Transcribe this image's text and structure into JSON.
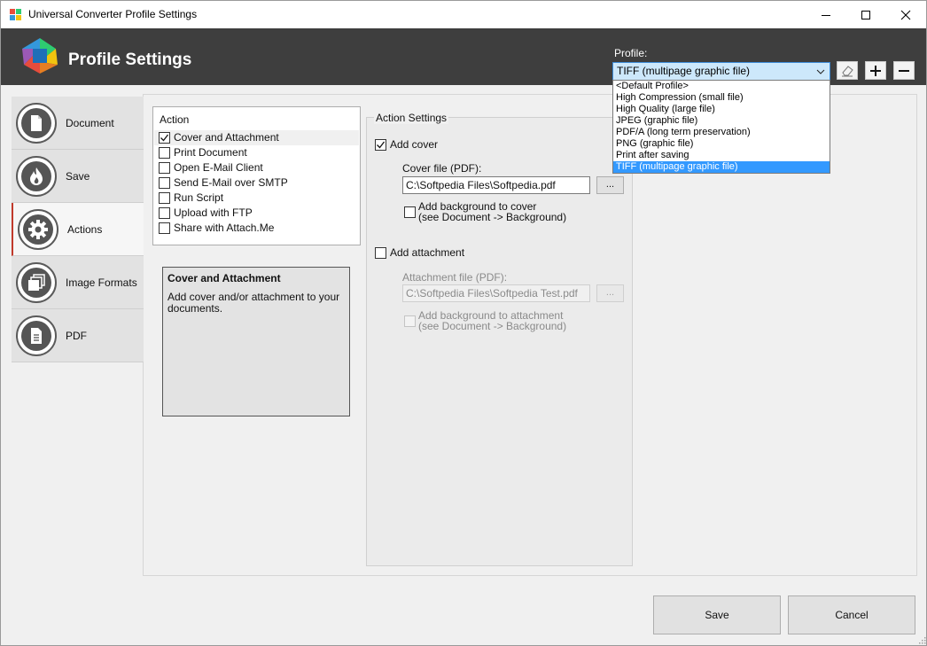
{
  "window": {
    "title": "Universal Converter Profile Settings",
    "controls": {
      "minimize": "minimize",
      "maximize": "maximize",
      "close": "close"
    }
  },
  "header": {
    "title": "Profile Settings",
    "profile_label": "Profile:",
    "profile_selected": "TIFF (multipage graphic file)",
    "profile_options": [
      "<Default Profile>",
      "High Compression (small file)",
      "High Quality (large file)",
      "JPEG (graphic file)",
      "PDF/A (long term preservation)",
      "PNG (graphic file)",
      "Print after saving",
      "TIFF (multipage graphic file)"
    ],
    "selected_index": 7
  },
  "tabs": [
    {
      "label": "Document",
      "icon": "document-icon"
    },
    {
      "label": "Save",
      "icon": "flame-icon"
    },
    {
      "label": "Actions",
      "icon": "gear-icon"
    },
    {
      "label": "Image Formats",
      "icon": "image-stack-icon"
    },
    {
      "label": "PDF",
      "icon": "pdf-file-icon"
    }
  ],
  "active_tab": "Actions",
  "actions": {
    "header": "Action",
    "items": [
      {
        "label": "Cover and Attachment",
        "checked": true
      },
      {
        "label": "Print Document",
        "checked": false
      },
      {
        "label": "Open E-Mail Client",
        "checked": false
      },
      {
        "label": "Send E-Mail over SMTP",
        "checked": false
      },
      {
        "label": "Run Script",
        "checked": false
      },
      {
        "label": "Upload with FTP",
        "checked": false
      },
      {
        "label": "Share with Attach.Me",
        "checked": false
      }
    ]
  },
  "description": {
    "title": "Cover and Attachment",
    "text": "Add cover and/or attachment to your documents."
  },
  "settings": {
    "legend": "Action Settings",
    "add_cover_label": "Add cover",
    "add_cover_checked": true,
    "cover_file_label": "Cover file (PDF):",
    "cover_file_value": "C:\\Softpedia Files\\Softpedia.pdf",
    "browse_label": "...",
    "cover_bg_line1": "Add background to cover",
    "cover_bg_line2": "(see Document -> Background)",
    "add_attachment_label": "Add attachment",
    "add_attachment_checked": false,
    "attachment_file_label": "Attachment file (PDF):",
    "attachment_file_value": "C:\\Softpedia Files\\Softpedia Test.pdf",
    "attach_bg_line1": "Add background to attachment",
    "attach_bg_line2": "(see Document -> Background)"
  },
  "buttons": {
    "save": "Save",
    "cancel": "Cancel"
  },
  "colors": {
    "header_bg": "#3e3e3e",
    "selection": "#3399ff",
    "active_tab_accent": "#c0392b"
  }
}
